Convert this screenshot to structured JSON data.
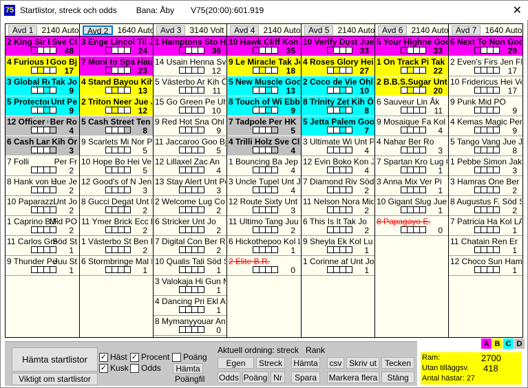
{
  "window": {
    "icon": "75",
    "title": "Startlistor, streck och odds",
    "track": "Bana: Åby",
    "game": "V75(20:00):601.919",
    "close": "✕"
  },
  "colors": {
    "A": "#ff00ff",
    "B": "#ffff00",
    "C": "#00ffff",
    "D": "#c0c0c0"
  },
  "columns": [
    {
      "avd": "Avd 1",
      "info": "2140 Auto",
      "rows": [
        {
          "t": "2 King Sir K",
          "r": "Sve Cl",
          "n": "48",
          "g": "A"
        },
        {
          "t": "4 Furious Fi",
          "r": "Goo Bj",
          "n": "17",
          "g": "B"
        },
        {
          "t": "3 Global Rej",
          "r": "Tak Jo",
          "n": "9",
          "g": "C"
        },
        {
          "t": "5 Protector",
          "r": "Unt Pe",
          "n": "9",
          "g": "C"
        },
        {
          "t": "12 Officer C.",
          "r": "Ber Ro",
          "n": "4",
          "g": "D"
        },
        {
          "t": "6 Cash Lan",
          "r": "Kih Ör",
          "n": "3",
          "g": "D"
        },
        {
          "t": "7 Folli",
          "r": "Per Fr",
          "n": "2"
        },
        {
          "t": "8 Hank von H",
          "r": "Jue Je",
          "n": "2"
        },
        {
          "t": "10 Paparazzi",
          "r": "Unt Jo",
          "n": "2"
        },
        {
          "t": "1 Caprino B.F",
          "r": "Mid PO",
          "n": "2"
        },
        {
          "t": "11 Carlos Gre",
          "r": "Söd St",
          "n": "1"
        },
        {
          "t": "9 Thunder Pe",
          "r": "Juu St",
          "n": "1"
        }
      ]
    },
    {
      "avd": "Avd 2",
      "info": "1640 Auto",
      "selected": true,
      "rows": [
        {
          "t": "3 Enge Lincol Til Je",
          "n": "24",
          "g": "A"
        },
        {
          "t": "7 Moni to Spa Hau",
          "n": "23",
          "g": "A"
        },
        {
          "t": "4 Stand Bayou Kih Ö",
          "n": "13",
          "g": "B"
        },
        {
          "t": "2 Triton Neer Jue J",
          "n": "12",
          "g": "B"
        },
        {
          "t": "5 Cash Street Ten",
          "n": "8",
          "g": "D"
        },
        {
          "t": "9 Scarlets Mi Nor PG",
          "n": "5"
        },
        {
          "t": "10 Hope Bo Hei Ve",
          "n": "5"
        },
        {
          "t": "12 Good's of N Jen Fl",
          "n": "3"
        },
        {
          "t": "8 Gucci Degat Unt Pe",
          "n": "2"
        },
        {
          "t": "11 Ymer Brick Ecc Ke",
          "n": "2"
        },
        {
          "t": "1 Västerbo St Ben N",
          "n": "2"
        },
        {
          "t": "6 Stormbringe Mal Kr",
          "n": "1"
        }
      ]
    },
    {
      "avd": "Avd 3",
      "info": "3140 Volt",
      "rows": [
        {
          "t": "1 Hamptons Sto HV",
          "n": "36",
          "g": "A"
        },
        {
          "t": "14 Usain Henna Sva",
          "n": "12"
        },
        {
          "t": "5 Västerbo Ar Kih Ör",
          "n": "11"
        },
        {
          "t": "15 Go Green Pe Uhr T",
          "n": "10"
        },
        {
          "t": "9 Red Hot Sna Ohl Ul",
          "n": "9"
        },
        {
          "t": "11 Jaccaroo Goo Bj",
          "n": "5"
        },
        {
          "t": "12 Lillaxel Zac An",
          "n": "4"
        },
        {
          "t": "13 Stay Alert Unt Pe",
          "n": "3"
        },
        {
          "t": "2 Welcome Lug Co",
          "n": "2"
        },
        {
          "t": "6 Stricker Unt Jo",
          "n": "2"
        },
        {
          "t": "7 Digital Con Ber Ro",
          "n": "2"
        },
        {
          "t": "10 Qualis Tali Söd St",
          "n": "1"
        },
        {
          "t": "3 Valokaja Hi Gun MT",
          "n": "1"
        },
        {
          "t": "4 Dancing Pri Ekl An",
          "n": "1"
        },
        {
          "t": "8 Mymanyyouar Ant",
          "n": "0"
        }
      ]
    },
    {
      "avd": "Avd 4",
      "info": "2140 Auto",
      "rows": [
        {
          "t": "10 Hawk Cliff Kon J",
          "n": "35",
          "g": "A"
        },
        {
          "t": "9 Le Miracle Tak Jo",
          "n": "18",
          "g": "B"
        },
        {
          "t": "5 New Muscle Goo",
          "n": "13",
          "g": "C"
        },
        {
          "t": "8 Touch of Wi Ebb I",
          "n": "9",
          "g": "C"
        },
        {
          "t": "7 Tadpole Per HK",
          "n": "5",
          "g": "D"
        },
        {
          "t": "4 Trilli Holz Sve Cl",
          "n": "4",
          "g": "D"
        },
        {
          "t": "1 Bouncing Ba Jep C",
          "n": "4"
        },
        {
          "t": "3 Uncle Tupel Unt Jo",
          "n": "4"
        },
        {
          "t": "12 Route Sixty Unt Pe",
          "n": "3"
        },
        {
          "t": "11 Ultimo Tang Juu St",
          "n": "2"
        },
        {
          "t": "6 Hickothepoo Kol LA",
          "n": "1"
        },
        {
          "t": "2 Elite B.R.",
          "n": "0",
          "s": true
        }
      ]
    },
    {
      "avd": "Avd 5",
      "info": "2140 Auto",
      "rows": [
        {
          "t": "10 Verify Dust Jue J",
          "n": "33",
          "g": "A"
        },
        {
          "t": "4 Roses Glory Hei",
          "n": "27",
          "g": "B"
        },
        {
          "t": "2 Coco de Vie Ohl",
          "n": "10",
          "g": "C"
        },
        {
          "t": "8 Trinity Zet Kih Ör",
          "n": "8",
          "g": "C"
        },
        {
          "t": "5 Jetta Palem Goo",
          "n": "7",
          "g": "C"
        },
        {
          "t": "3 Ultimate Wi Unt Pe",
          "n": "4"
        },
        {
          "t": "12 Evin Boko Kon Jo",
          "n": "4"
        },
        {
          "t": "7 Diamond Riv Söd S",
          "n": "2"
        },
        {
          "t": "11 Nelson Nora Mid P",
          "n": "2"
        },
        {
          "t": "6 This Is It  Tak Jo",
          "n": "2"
        },
        {
          "t": "9 Sheyla Ek Kol Lu",
          "n": "1"
        },
        {
          "t": "1 Corinne af  Unt Jo",
          "n": "1"
        }
      ]
    },
    {
      "avd": "Avd 6",
      "info": "2140 Auto",
      "rows": [
        {
          "t": "5 Your Highne Goo",
          "n": "33",
          "g": "A"
        },
        {
          "t": "1 On Track Pi Tak J",
          "n": "22",
          "g": "B"
        },
        {
          "t": "2 B.B.S.Sugar Unt F",
          "n": "20",
          "g": "B"
        },
        {
          "t": "6 Sauveur Lin Åk",
          "n": "11"
        },
        {
          "t": "9 Mosaique Fa Kol Lu",
          "n": "4"
        },
        {
          "t": "4 Nahar Ber Ro",
          "n": "3"
        },
        {
          "t": "7 Spartan Kro Lug C",
          "n": "1"
        },
        {
          "t": "3 Anna Mix Ver Pi",
          "n": "1"
        },
        {
          "t": "10 Gigant Slug Jue Je",
          "n": "1"
        },
        {
          "t": "8 Papagayo E.",
          "n": "0",
          "s": true
        }
      ]
    },
    {
      "avd": "Avd 7",
      "info": "1640 Auto",
      "rows": [
        {
          "t": "6 Next To Non Goo",
          "n": "29",
          "g": "A"
        },
        {
          "t": "2 Even's Firs Jen Fl",
          "n": "17"
        },
        {
          "t": "10 Fridericus Hei Ve",
          "n": "17"
        },
        {
          "t": "9 Punk Mid PO",
          "n": "9"
        },
        {
          "t": "4 Kemas Magic Per F",
          "n": "9"
        },
        {
          "t": "5 Tango Vang Jue Je",
          "n": "8"
        },
        {
          "t": "1 Pebbe Simon Jak M",
          "n": "3"
        },
        {
          "t": "3 Hamras One  Ber C",
          "n": "2"
        },
        {
          "t": "8 Augustus F. Söd St",
          "n": "2"
        },
        {
          "t": "7 Patricia Ha Kol LA",
          "n": "1"
        },
        {
          "t": "11 Chatain Ren Er",
          "n": "1"
        },
        {
          "t": "12 Choco Sun Ham Fr",
          "n": "1"
        }
      ]
    }
  ],
  "controls": {
    "fetch": "Hämta startlistor",
    "important": "Viktigt om startlistor",
    "chk_hast": {
      "label": "Häst",
      "checked": true
    },
    "chk_kusk": {
      "label": "Kusk",
      "checked": true
    },
    "chk_procent": {
      "label": "Procent",
      "checked": true
    },
    "chk_odds": {
      "label": "Odds",
      "checked": false
    },
    "chk_poang": {
      "label": "Poäng",
      "checked": false
    },
    "fetch_points": "Hämta",
    "points_file": "Poängfil",
    "order_label": "Aktuell ordning: streck   Rank",
    "b_egen": "Egen",
    "b_streck": "Streck",
    "b_hamta": "Hämta",
    "b_csv": "csv",
    "b_skriv": "Skriv ut",
    "b_tecken": "Tecken",
    "b_odds": "Odds",
    "b_poang": "Poäng",
    "b_nr": "Nr",
    "b_spara": "Spara",
    "b_markera": "Markera flera",
    "b_stang": "Stäng"
  },
  "legend": [
    "A",
    "B",
    "C",
    "D"
  ],
  "stats": {
    "ram_label": "Ram:",
    "ram": "2700",
    "utan_label": "Utan tilläggsv.",
    "utan": "418",
    "antal": "Antal hästar: 27"
  }
}
